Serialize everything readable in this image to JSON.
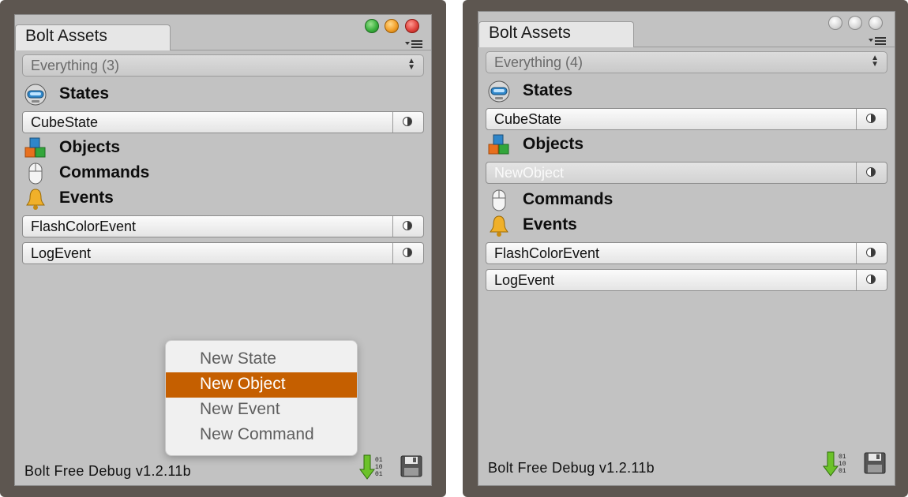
{
  "left_window": {
    "tab_title": "Bolt Assets",
    "filter_dropdown": {
      "value": "Everything (3)"
    },
    "sections": {
      "states": {
        "label": "States",
        "items": [
          "CubeState"
        ]
      },
      "objects": {
        "label": "Objects",
        "items": []
      },
      "commands": {
        "label": "Commands",
        "items": []
      },
      "events": {
        "label": "Events",
        "items": [
          "FlashColorEvent",
          "LogEvent"
        ]
      }
    },
    "context_menu": {
      "items": [
        "New State",
        "New Object",
        "New Event",
        "New Command"
      ],
      "highlighted": "New Object"
    },
    "footer_version": "Bolt Free Debug v1.2.11b"
  },
  "right_window": {
    "tab_title": "Bolt Assets",
    "filter_dropdown": {
      "value": "Everything (4)"
    },
    "sections": {
      "states": {
        "label": "States",
        "items": [
          "CubeState"
        ]
      },
      "objects": {
        "label": "Objects",
        "items": [
          "NewObject"
        ]
      },
      "commands": {
        "label": "Commands",
        "items": []
      },
      "events": {
        "label": "Events",
        "items": [
          "FlashColorEvent",
          "LogEvent"
        ]
      }
    },
    "footer_version": "Bolt Free Debug v1.2.11b"
  },
  "icons": {
    "states": "robot-head-icon",
    "objects": "colored-blocks-icon",
    "commands": "mouse-icon",
    "events": "bell-icon",
    "compile": "download-arrow-icon",
    "save": "floppy-disk-icon"
  },
  "colors": {
    "menu_highlight": "#c55f00",
    "close_button": "#e0443e",
    "minimize_button": "#f2a02b",
    "zoom_button": "#3cb13f"
  }
}
